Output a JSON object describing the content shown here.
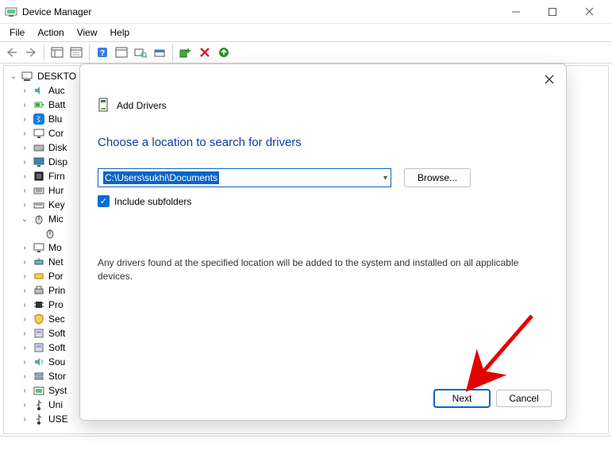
{
  "window": {
    "title": "Device Manager",
    "menus": [
      "File",
      "Action",
      "View",
      "Help"
    ]
  },
  "tree": {
    "root_label": "DESKTO",
    "items": [
      {
        "label": "Auc",
        "icon": "audio"
      },
      {
        "label": "Batt",
        "icon": "battery"
      },
      {
        "label": "Blu",
        "icon": "bluetooth"
      },
      {
        "label": "Cor",
        "icon": "monitor"
      },
      {
        "label": "Disk",
        "icon": "disk"
      },
      {
        "label": "Disp",
        "icon": "display"
      },
      {
        "label": "Firn",
        "icon": "firmware"
      },
      {
        "label": "Hur",
        "icon": "hid"
      },
      {
        "label": "Key",
        "icon": "keyboard"
      },
      {
        "label": "Mic",
        "icon": "mouse",
        "expanded": true,
        "children": [
          {
            "label": "",
            "icon": "mouse-sub"
          }
        ]
      },
      {
        "label": "Mo",
        "icon": "monitor2"
      },
      {
        "label": "Net",
        "icon": "network"
      },
      {
        "label": "Por",
        "icon": "port"
      },
      {
        "label": "Prin",
        "icon": "printer"
      },
      {
        "label": "Pro",
        "icon": "processor"
      },
      {
        "label": "Sec",
        "icon": "security"
      },
      {
        "label": "Soft",
        "icon": "software"
      },
      {
        "label": "Soft",
        "icon": "software"
      },
      {
        "label": "Sou",
        "icon": "sound"
      },
      {
        "label": "Stor",
        "icon": "storage"
      },
      {
        "label": "Syst",
        "icon": "system"
      },
      {
        "label": "Uni",
        "icon": "usb"
      },
      {
        "label": "USE",
        "icon": "usb"
      }
    ]
  },
  "dialog": {
    "title": "Add Drivers",
    "heading": "Choose a location to search for drivers",
    "path": "C:\\Users\\sukhi\\Documents",
    "browse_label": "Browse...",
    "include_label": "Include subfolders",
    "include_checked": true,
    "info": "Any drivers found at the specified location will be added to the system and installed on all applicable devices.",
    "next_label": "Next",
    "cancel_label": "Cancel"
  },
  "annotation": {
    "arrow_color": "#e40000"
  }
}
